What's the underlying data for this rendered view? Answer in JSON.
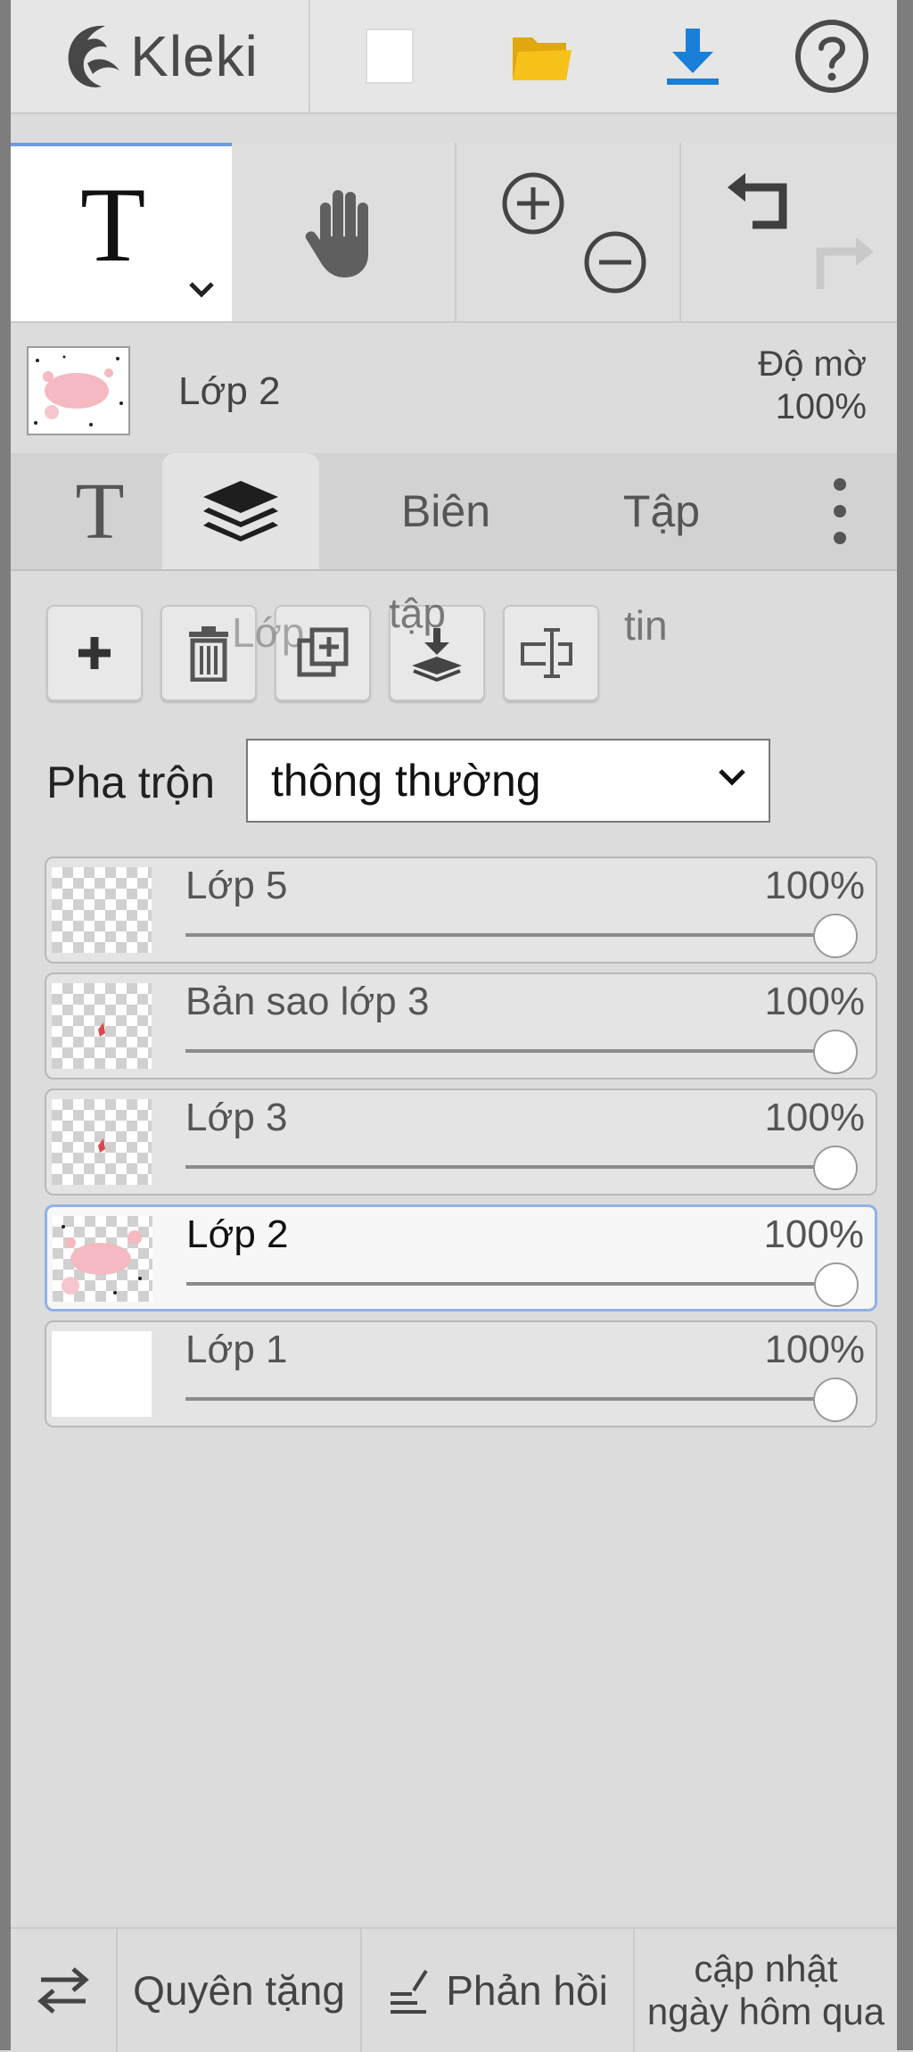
{
  "app": {
    "name": "Kleki"
  },
  "top": {
    "new_icon": "new-file-icon",
    "open_icon": "open-folder-icon",
    "save_icon": "download-icon",
    "help_icon": "help-icon"
  },
  "tools": {
    "active_tool_icon": "text-tool-icon",
    "hand_icon": "hand-icon",
    "zoom_in_icon": "zoom-in-icon",
    "zoom_out_icon": "zoom-out-icon",
    "undo_icon": "undo-icon",
    "redo_icon": "redo-icon"
  },
  "current_layer": {
    "name": "Lớp 2",
    "opacity_label": "Độ mờ",
    "opacity_value": "100%"
  },
  "tabs": [
    {
      "label": "T",
      "icon": "text-tab-icon"
    },
    {
      "label": "",
      "icon": "layers-icon"
    },
    {
      "label": "Biên"
    },
    {
      "label": "Tập"
    },
    {
      "label": "",
      "icon": "more-vertical-icon"
    }
  ],
  "layer_toolbar": {
    "ghost_text": [
      "Lớp",
      "tập",
      "tin"
    ],
    "buttons": [
      "add-layer-icon",
      "delete-layer-icon",
      "duplicate-layer-icon",
      "merge-down-icon",
      "rename-layer-icon"
    ]
  },
  "blend": {
    "label": "Pha trộn",
    "selected": "thông thường"
  },
  "layers": [
    {
      "name": "Lớp 5",
      "opacity": "100%",
      "opacity_value": 1.0,
      "thumb": "empty",
      "active": false
    },
    {
      "name": "Bản sao lớp 3",
      "opacity": "100%",
      "opacity_value": 1.0,
      "thumb": "red-mark",
      "active": false
    },
    {
      "name": "Lớp 3",
      "opacity": "100%",
      "opacity_value": 1.0,
      "thumb": "red-mark",
      "active": false
    },
    {
      "name": "Lớp 2",
      "opacity": "100%",
      "opacity_value": 1.0,
      "thumb": "pink-blob",
      "active": true
    },
    {
      "name": "Lớp 1",
      "opacity": "100%",
      "opacity_value": 1.0,
      "thumb": "white",
      "active": false
    }
  ],
  "bottom": {
    "swap_icon": "swap-arrows-icon",
    "donate": "Quyên tặng",
    "feedback_icon": "feedback-pen-icon",
    "feedback": "Phản hồi",
    "update_line1": "cập nhật",
    "update_line2": "ngày hôm qua"
  },
  "colors": {
    "accent": "#6b9be0",
    "save_blue": "#1a7fd8",
    "folder_yellow": "#f6c21a",
    "layer_pink": "#f4b9c1"
  }
}
